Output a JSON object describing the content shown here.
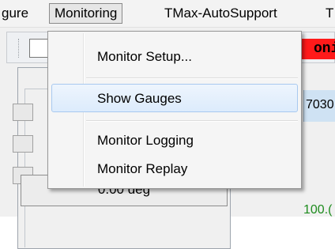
{
  "menubar": {
    "items": [
      {
        "label": "gure"
      },
      {
        "label": "Monitoring"
      },
      {
        "label": "TMax-AutoSupport"
      },
      {
        "label": "T"
      }
    ]
  },
  "toolbar": {
    "red_label": "onit"
  },
  "panel": {
    "deg_value": "0.00 deg"
  },
  "right": {
    "header_value": "7030",
    "green_value": "100.("
  },
  "dropdown": {
    "items": [
      {
        "label": "Monitor Setup..."
      },
      {
        "label": "Show Gauges"
      },
      {
        "label": "Monitor Logging"
      },
      {
        "label": "Monitor Replay"
      }
    ]
  },
  "colors": {
    "highlight": "#dcebfc",
    "red_label_bg": "#ff1a1a",
    "green_text": "#1e8c1e"
  }
}
